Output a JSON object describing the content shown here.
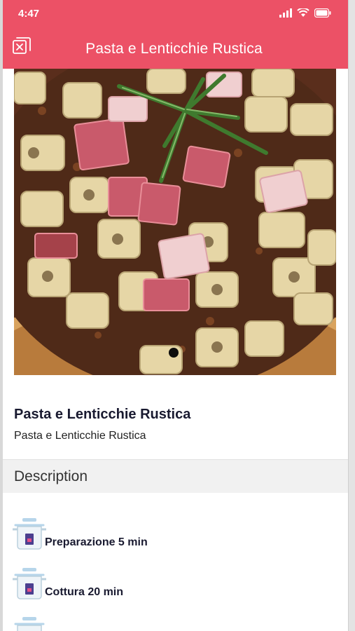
{
  "status_bar": {
    "time": "4:47",
    "icons": [
      "signal-icon",
      "wifi-icon",
      "battery-icon"
    ]
  },
  "app_bar": {
    "title": "Pasta e Lenticchie Rustica",
    "back_icon": "close-square-icon"
  },
  "hero": {
    "image_subject": "pasta with lentils, pancetta and rosemary",
    "page_indicator": {
      "current": 1,
      "total": 1
    }
  },
  "recipe": {
    "title": "Pasta e Lenticchie Rustica",
    "subtitle": "Pasta e Lenticchie Rustica"
  },
  "section": {
    "description_label": "Description"
  },
  "info_items": [
    {
      "icon": "cooking-pot-icon",
      "label": "Preparazione 5 min"
    },
    {
      "icon": "cooking-pot-icon",
      "label": "Cottura 20 min"
    },
    {
      "icon": "cooking-pot-icon",
      "label": ""
    }
  ],
  "colors": {
    "accent": "#ec5166",
    "text_dark": "#191a30",
    "section_bg": "#f1f1f1"
  }
}
